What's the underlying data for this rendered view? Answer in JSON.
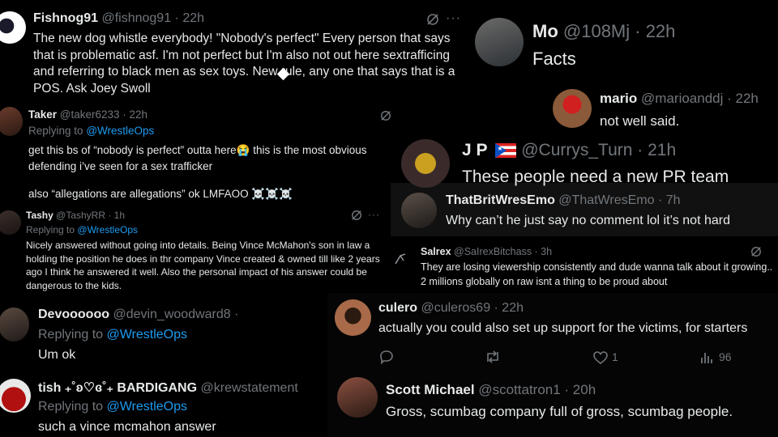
{
  "t1": {
    "name": "Fishnog91",
    "meta": "@fishnog91 · 22h",
    "text": "The new dog whistle everybody! \"Nobody's perfect\" Every person that says that is problematic asf. I'm not perfect but I'm also not out here sextrafficing and referring to black men as sex toys. New rule, any one that says that is a POS. Ask Joey Swoll",
    "more": "···"
  },
  "t2": {
    "name": "Taker",
    "meta": "@taker6233 · 22h",
    "replying": "Replying to",
    "reply_to": "@WrestleOps",
    "text1": "get this bs of “nobody is perfect” outta here😭 this is the most obvious defending i’ve seen for a sex trafficker",
    "text2": "also “allegations are allegations” ok LMFAOO ☠️☠️☠️"
  },
  "t3": {
    "name": "Tashy",
    "meta": "@TashyRR · 1h",
    "replying": "Replying to",
    "reply_to": "@WrestleOps",
    "text": "Nicely answered without going into details. Being Vince McMahon's son in law a holding the position he does in thr company Vince created & owned till like 2 years ago I think he answered it well. Also the personal impact of his answer could be dangerous to the kids.",
    "more": "···"
  },
  "t4": {
    "name": "Devoooooo",
    "meta": "@devin_woodward8 ·",
    "replying": "Replying to",
    "reply_to": "@WrestleOps",
    "text": "Um ok"
  },
  "t5": {
    "name": "tish ₊˚ʚ♡ɞ˚₊ BARDIGANG",
    "meta": "@krewstatement",
    "replying": "Replying to",
    "reply_to": "@WrestleOps",
    "text": "such a vince mcmahon answer"
  },
  "t6": {
    "name": "Mo",
    "meta": "@108Mj · 22h",
    "text": "Facts"
  },
  "t7": {
    "name": "mario",
    "meta": "@marioanddj · 22h",
    "text": "not well said."
  },
  "t8": {
    "name": "J P",
    "meta": "@Currys_Turn · 21h",
    "text": "These people need a new PR team"
  },
  "t9": {
    "name": "ThatBritWresEmo",
    "meta": "@ThatWresEmo · 7h",
    "text": "Why can’t he just say no comment lol it’s not hard"
  },
  "t10": {
    "name": "Salrex",
    "meta": "@SaIrexBitchass · 3h",
    "text": "They are losing viewership consistently and dude wanna talk about it growing.. 2 millions globally on raw isnt a thing to be proud about"
  },
  "t11": {
    "name": "culero",
    "meta": "@culeros69 · 22h",
    "text": "actually you could also set up support for the victims, for starters",
    "likes": "1",
    "views": "96"
  },
  "t12": {
    "name": "Scott Michael",
    "meta": "@scottatron1 · 20h",
    "text": "Gross, scumbag company full of gross, scumbag people."
  }
}
